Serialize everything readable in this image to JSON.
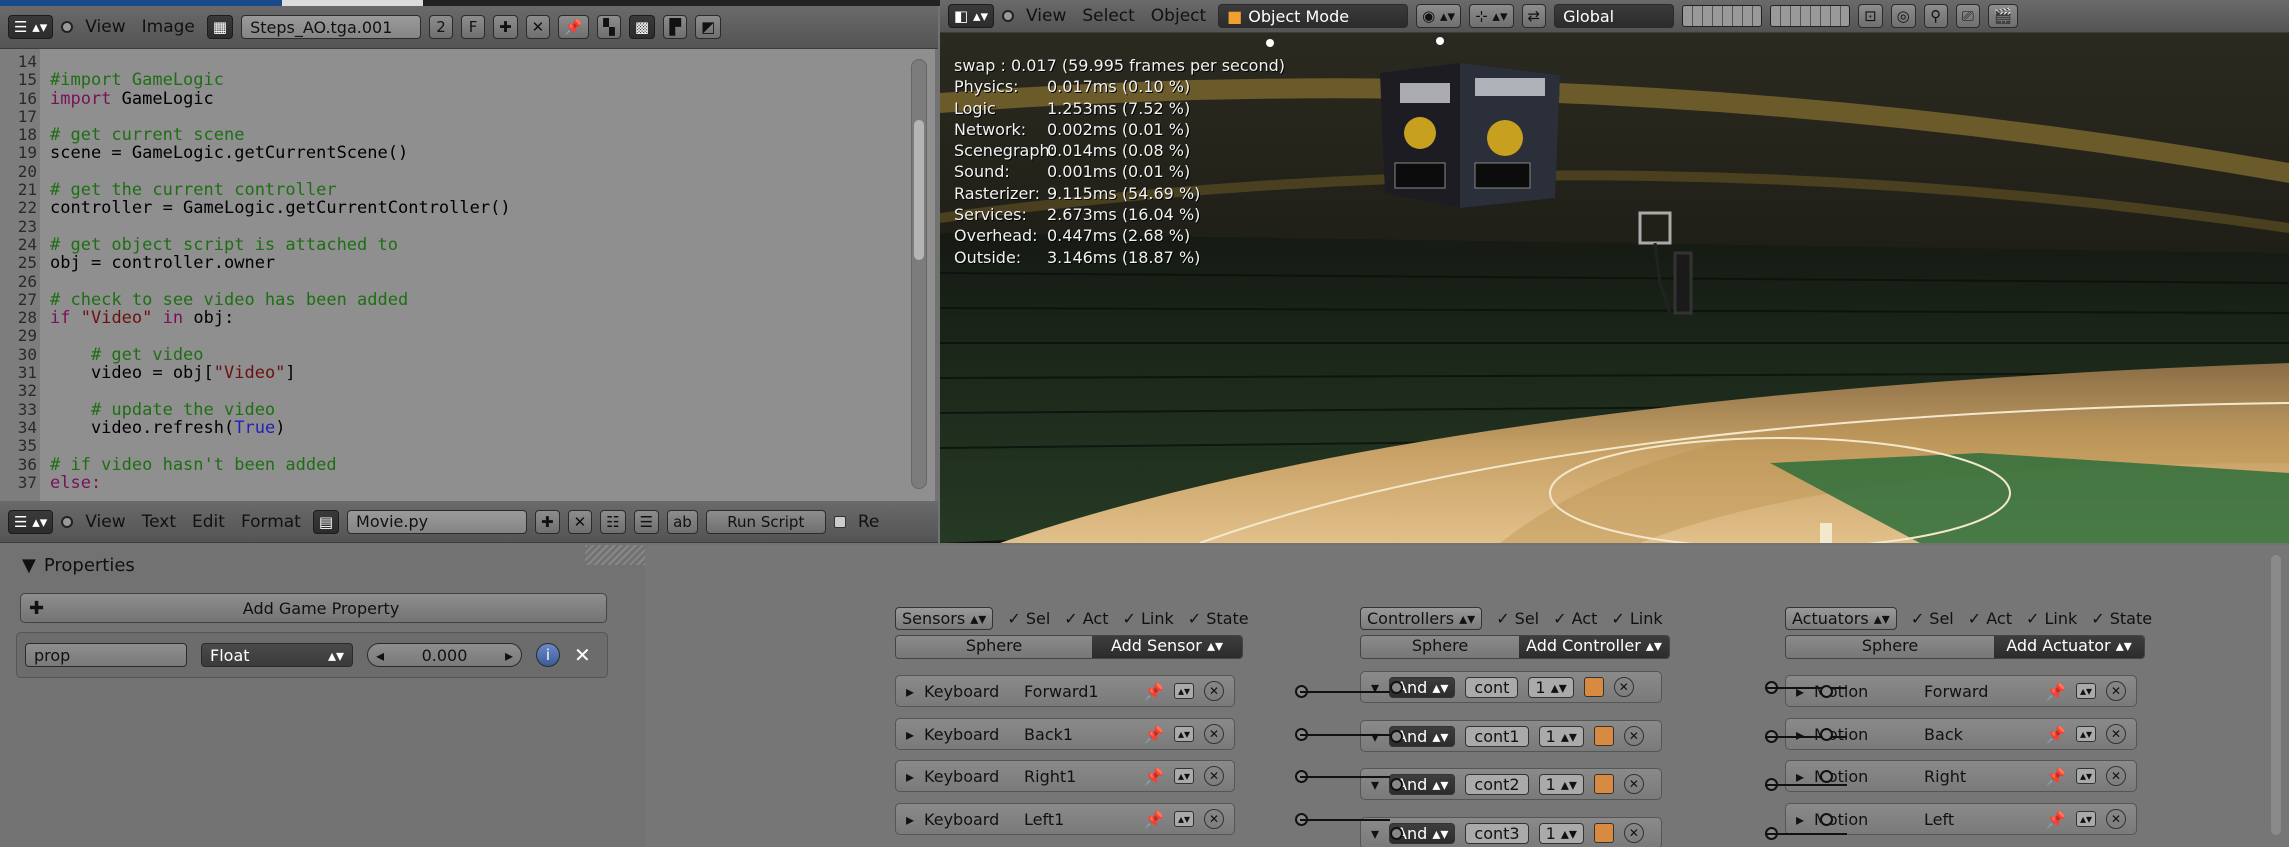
{
  "image_header": {
    "menu_view": "View",
    "menu_image": "Image",
    "image_name": "Steps_AO.tga.001",
    "users": "2",
    "fake": "F"
  },
  "view3d_header": {
    "menu_view": "View",
    "menu_select": "Select",
    "menu_object": "Object",
    "mode": "Object Mode",
    "orientation": "Global"
  },
  "text_editor": {
    "line_numbers": [
      "14",
      "15",
      "16",
      "17",
      "18",
      "19",
      "20",
      "21",
      "22",
      "23",
      "24",
      "25",
      "26",
      "27",
      "28",
      "29",
      "30",
      "31",
      "32",
      "33",
      "34",
      "35",
      "36",
      "37"
    ],
    "lines": [
      {
        "t": "",
        "c": ""
      },
      {
        "t": "#import GameLogic",
        "c": "cm"
      },
      {
        "t": "import GameLogic",
        "c": "imp"
      },
      {
        "t": "",
        "c": ""
      },
      {
        "t": "# get current scene",
        "c": "cm"
      },
      {
        "t": "scene = GameLogic.getCurrentScene()",
        "c": ""
      },
      {
        "t": "",
        "c": ""
      },
      {
        "t": "# get the current controller",
        "c": "cm"
      },
      {
        "t": "controller = GameLogic.getCurrentController()",
        "c": ""
      },
      {
        "t": "",
        "c": ""
      },
      {
        "t": "# get object script is attached to",
        "c": "cm"
      },
      {
        "t": "obj = controller.owner",
        "c": ""
      },
      {
        "t": "",
        "c": ""
      },
      {
        "t": "# check to see video has been added",
        "c": "cm"
      },
      {
        "t": "if \"Video\" in obj:",
        "c": "if"
      },
      {
        "t": "",
        "c": ""
      },
      {
        "t": "    # get video",
        "c": "cm"
      },
      {
        "t": "    video = obj[\"Video\"]",
        "c": "vid"
      },
      {
        "t": "",
        "c": ""
      },
      {
        "t": "    # update the video",
        "c": "cm"
      },
      {
        "t": "    video.refresh(True)",
        "c": "ref"
      },
      {
        "t": "",
        "c": ""
      },
      {
        "t": "# if video hasn't been added",
        "c": "cm"
      },
      {
        "t": "else:",
        "c": "kw"
      }
    ]
  },
  "text_header": {
    "menu_view": "View",
    "menu_text": "Text",
    "menu_edit": "Edit",
    "menu_format": "Format",
    "file_name": "Movie.py",
    "run_script": "Run Script",
    "register": "Re"
  },
  "stats": [
    {
      "label": "swap :",
      "value": "0.017 (59.995 frames per second)"
    },
    {
      "label": "Physics:",
      "value": "0.017ms (0.10 %)"
    },
    {
      "label": "Logic",
      "value": "1.253ms (7.52 %)"
    },
    {
      "label": "Network:",
      "value": "0.002ms (0.01 %)"
    },
    {
      "label": "Scenegraph:",
      "value": "0.014ms (0.08 %)"
    },
    {
      "label": "Sound:",
      "value": "0.001ms (0.01 %)"
    },
    {
      "label": "Rasterizer:",
      "value": "9.115ms (54.69 %)"
    },
    {
      "label": "Services:",
      "value": "2.673ms (16.04 %)"
    },
    {
      "label": "Overhead:",
      "value": "0.447ms (2.68 %)"
    },
    {
      "label": "Outside:",
      "value": "3.146ms (18.87 %)"
    }
  ],
  "properties": {
    "title": "Properties",
    "add_button": "Add Game Property",
    "prop_name": "prop",
    "prop_type": "Float",
    "prop_value": "0.000"
  },
  "logic": {
    "sensors": {
      "title": "Sensors",
      "sel": "Sel",
      "act": "Act",
      "link": "Link",
      "state": "State",
      "object": "Sphere",
      "add": "Add Sensor",
      "items": [
        {
          "type": "Keyboard",
          "name": "Forward1"
        },
        {
          "type": "Keyboard",
          "name": "Back1"
        },
        {
          "type": "Keyboard",
          "name": "Right1"
        },
        {
          "type": "Keyboard",
          "name": "Left1"
        }
      ]
    },
    "controllers": {
      "title": "Controllers",
      "sel": "Sel",
      "act": "Act",
      "link": "Link",
      "object": "Sphere",
      "add": "Add Controller",
      "items": [
        {
          "type": "And",
          "name": "cont",
          "num": "1"
        },
        {
          "type": "And",
          "name": "cont1",
          "num": "1"
        },
        {
          "type": "And",
          "name": "cont2",
          "num": "1"
        },
        {
          "type": "And",
          "name": "cont3",
          "num": "1"
        }
      ]
    },
    "actuators": {
      "title": "Actuators",
      "sel": "Sel",
      "act": "Act",
      "link": "Link",
      "state": "State",
      "object": "Sphere",
      "add": "Add Actuator",
      "items": [
        {
          "type": "Motion",
          "name": "Forward"
        },
        {
          "type": "Motion",
          "name": "Back"
        },
        {
          "type": "Motion",
          "name": "Right"
        },
        {
          "type": "Motion",
          "name": "Left"
        }
      ]
    }
  },
  "colors": {
    "comment": "#1e6e14",
    "keyword": "#7a1059",
    "string": "#6b1010",
    "builtin": "#1f22b8",
    "floor": "#c8a267",
    "court_green": "#2e6e3b"
  }
}
